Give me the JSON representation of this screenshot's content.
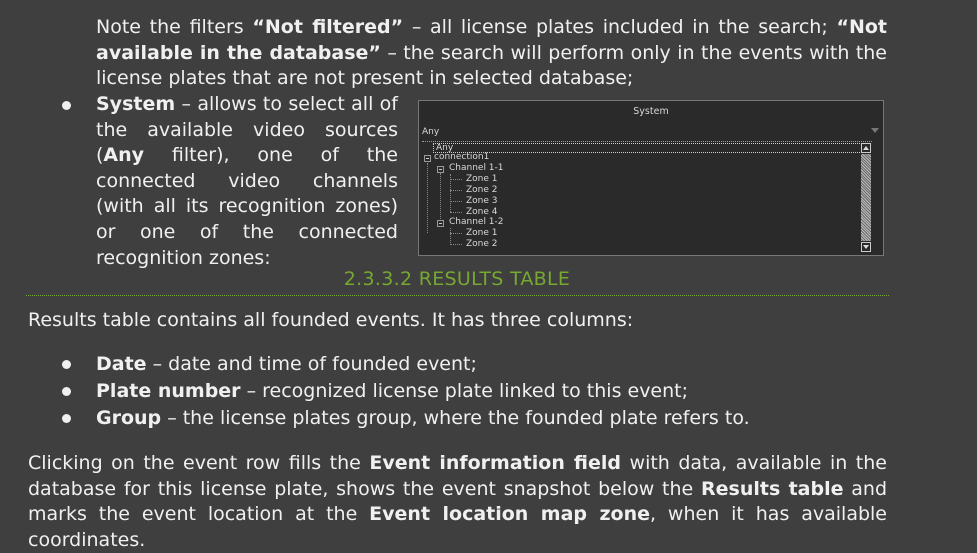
{
  "intro": {
    "t1": "Note the filters ",
    "b1": "“Not filtered”",
    "t2": " – all license plates included in the search; ",
    "b2": "“Not available in the database”",
    "t3": " – the search will perform only in the events with the license plates that are not present in selected database;"
  },
  "system_item": {
    "bold": "System",
    "t1": " – allows to select all of the available video sources (",
    "bold2": "Any",
    "t2": " filter), one of the connected video channels (with all its recognition zones) or one of the connected recognition zones:"
  },
  "widget": {
    "title": "System",
    "select_value": "Any",
    "tree": {
      "any": "Any",
      "connection": "connection1",
      "channel1": "Channel 1-1",
      "channel1_zones": [
        "Zone 1",
        "Zone 2",
        "Zone 3",
        "Zone 4"
      ],
      "channel2": "Channel 1-2",
      "channel2_zones": [
        "Zone 1",
        "Zone 2"
      ]
    }
  },
  "section": {
    "heading": "2.3.3.2 RESULTS TABLE",
    "accent_color": "#76a832"
  },
  "results_intro": "Results table contains all founded events. It has three columns:",
  "columns": [
    {
      "name": "Date",
      "desc": " – date and time of founded event;"
    },
    {
      "name": "Plate number",
      "desc": " – recognized license plate linked to this event;"
    },
    {
      "name": "Group",
      "desc": " – the license plates group, where the founded plate refers to."
    }
  ],
  "closing": {
    "t1": "Clicking on the event row fills the ",
    "b1": "Event information field",
    "t2": " with data, available in the database for this license plate, shows the event snapshot below the ",
    "b2": "Results table",
    "t3": " and marks the event location at the ",
    "b3": "Event location map zone",
    "t4": ", when it has available coordinates."
  }
}
